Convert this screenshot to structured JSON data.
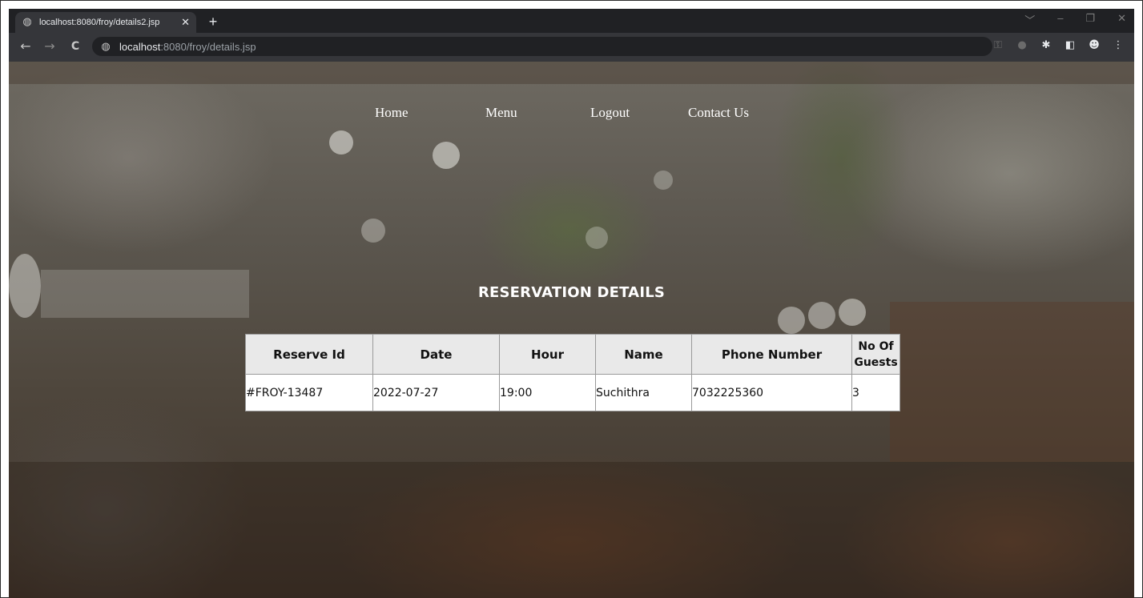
{
  "browser": {
    "tab": {
      "title": "localhost:8080/froy/details2.jsp",
      "favicon": "globe-icon",
      "close_glyph": "✕"
    },
    "new_tab_glyph": "+",
    "window_controls": [
      "﹀",
      "–",
      "❐",
      "✕"
    ],
    "nav": {
      "back_glyph": "←",
      "forward_glyph": "→",
      "reload_glyph": "C"
    },
    "address_bar": {
      "host": "localhost",
      "path": ":8080/froy/details.jsp",
      "site_icon": "globe-icon"
    },
    "toolbar_icons": [
      "key-icon",
      "extension-puzzle-icon",
      "side-panel-icon",
      "profile-icon",
      "menu-kebab-icon"
    ]
  },
  "site": {
    "nav": {
      "home": "Home",
      "menu": "Menu",
      "logout": "Logout",
      "contact": "Contact Us"
    },
    "heading": "RESERVATION DETAILS",
    "table": {
      "headers": {
        "reserve_id": "Reserve Id",
        "date": "Date",
        "hour": "Hour",
        "name": "Name",
        "phone": "Phone Number",
        "guests_line1": "No Of",
        "guests_line2": "Guests"
      },
      "rows": [
        {
          "reserve_id": "#FROY-13487",
          "date": "2022-07-27",
          "hour": "19:00",
          "name": "Suchithra",
          "phone": "7032225360",
          "guests": "3"
        }
      ]
    }
  },
  "colors": {
    "chrome_dark": "#202124",
    "chrome_toolbar": "#35363a",
    "header_cell": "#e9e9e9",
    "text_white": "#ffffff"
  }
}
